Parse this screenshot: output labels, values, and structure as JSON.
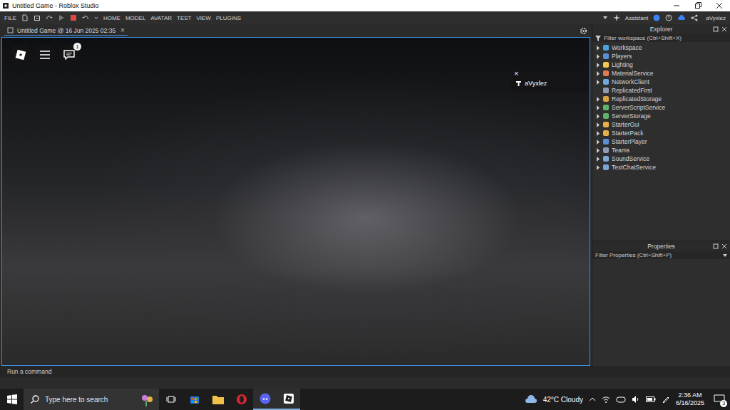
{
  "window": {
    "title": "Untitled Game - Roblox Studio"
  },
  "menu": {
    "items": [
      "FILE",
      "HOME",
      "MODEL",
      "AVATAR",
      "TEST",
      "VIEW",
      "PLUGINS"
    ],
    "assistant": "Assistant",
    "user": "aVyxlez"
  },
  "document_tab": {
    "label": "Untitled Game @ 16 Jun 2025 02:35",
    "close": "×",
    "selected": true
  },
  "game_overlay": {
    "chat_badge": "1",
    "leaderboard_close": "×",
    "player": "aVyxlez"
  },
  "explorer": {
    "title": "Explorer",
    "filter_placeholder": "Filter workspace (Ctrl+Shift+X)",
    "items": [
      {
        "name": "Workspace",
        "expandable": true,
        "color": "#4aa3df"
      },
      {
        "name": "Players",
        "expandable": true,
        "color": "#5b8fd6"
      },
      {
        "name": "Lighting",
        "expandable": true,
        "color": "#f2c94c"
      },
      {
        "name": "MaterialService",
        "expandable": true,
        "color": "#e07b53"
      },
      {
        "name": "NetworkClient",
        "expandable": true,
        "color": "#6fa8dc"
      },
      {
        "name": "ReplicatedFirst",
        "expandable": false,
        "color": "#8e9bb5"
      },
      {
        "name": "ReplicatedStorage",
        "expandable": true,
        "color": "#d9a441"
      },
      {
        "name": "ServerScriptService",
        "expandable": true,
        "color": "#5fb36b"
      },
      {
        "name": "ServerStorage",
        "expandable": true,
        "color": "#5fb36b"
      },
      {
        "name": "StarterGui",
        "expandable": true,
        "color": "#e8b04a"
      },
      {
        "name": "StarterPack",
        "expandable": true,
        "color": "#e8b04a"
      },
      {
        "name": "StarterPlayer",
        "expandable": true,
        "color": "#5b8fd6"
      },
      {
        "name": "Teams",
        "expandable": true,
        "color": "#8e9bb5"
      },
      {
        "name": "SoundService",
        "expandable": true,
        "color": "#7aa6d8"
      },
      {
        "name": "TextChatService",
        "expandable": true,
        "color": "#7aa6d8"
      }
    ]
  },
  "properties": {
    "title": "Properties",
    "filter_placeholder": "Filter Properties (Ctrl+Shift+P)"
  },
  "command_bar": {
    "placeholder": "Run a command"
  },
  "taskbar": {
    "search_placeholder": "Type here to search",
    "weather": "42°C Cloudy",
    "time": "2:36 AM",
    "date": "6/16/2025",
    "notification_count": "3"
  }
}
